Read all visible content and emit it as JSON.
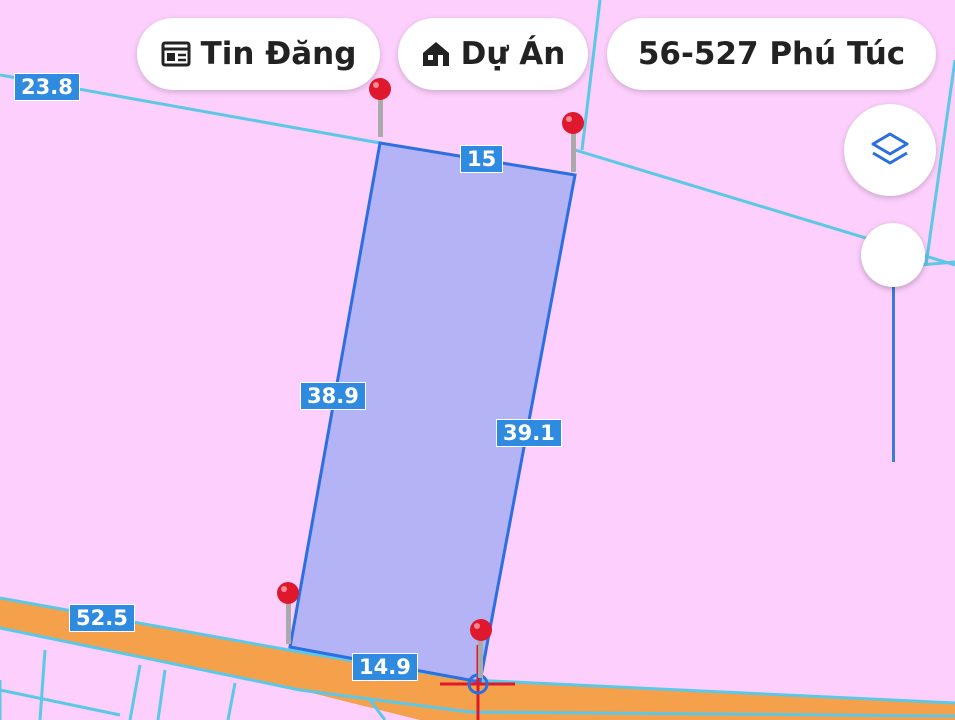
{
  "header": {
    "tin_dang_label": "Tin Đăng",
    "du_an_label": "Dự Án",
    "parcel_id": "56-527 Phú Túc"
  },
  "map": {
    "dimensions": {
      "top_edge": "15",
      "left_edge": "38.9",
      "right_edge": "39.1",
      "bottom_edge": "14.9",
      "neighbor_top_left": "23.8",
      "road_left": "52.5"
    },
    "colors": {
      "land": "#fccffc",
      "parcel_fill": "#b3b3f5",
      "parcel_outline": "#2b6fe0",
      "road": "#f5a04a",
      "boundary_lines": "#5bc8e8",
      "label_bg": "#2f8be0",
      "pin": "#e0182d"
    },
    "icons": {
      "tin_dang": "newspaper-icon",
      "du_an": "house-icon",
      "layers": "layers-icon",
      "pin": "map-pin-icon",
      "crosshair": "crosshair-icon"
    }
  }
}
